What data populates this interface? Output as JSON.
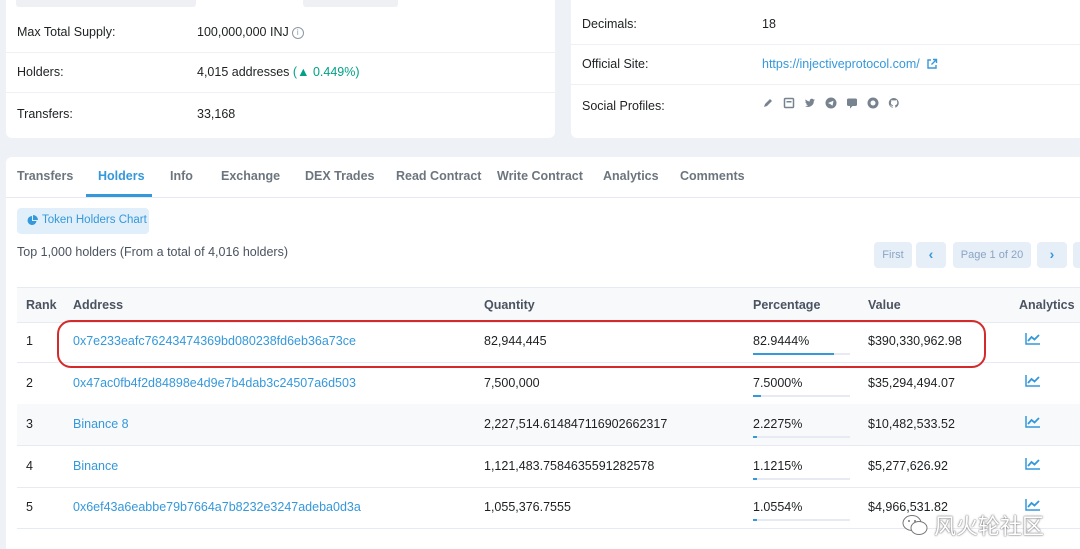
{
  "overview_left": {
    "rows": [
      {
        "key": "Max Total Supply:",
        "value": "100,000,000 INJ"
      },
      {
        "key": "Holders:",
        "value": "4,015 addresses",
        "change": "0.449%"
      },
      {
        "key": "Transfers:",
        "value": "33,168"
      }
    ]
  },
  "overview_right": {
    "rows": [
      {
        "key": "Decimals:",
        "value": "18"
      },
      {
        "key": "Official Site:",
        "value": "https://injectiveprotocol.com/"
      },
      {
        "key": "Social Profiles:"
      }
    ],
    "social_icons": [
      "pencil-icon",
      "blog-icon",
      "twitter-icon",
      "telegram-icon",
      "chat-icon",
      "coinmarketcap-icon",
      "github-icon"
    ]
  },
  "tabs": [
    "Transfers",
    "Holders",
    "Info",
    "Exchange",
    "DEX Trades",
    "Read Contract",
    "Write Contract",
    "Analytics",
    "Comments"
  ],
  "active_tab": "Holders",
  "holders_chart_button": "Token Holders Chart",
  "summary": "Top 1,000 holders (From a total of 4,016 holders)",
  "pager": {
    "first": "First",
    "page": "Page 1 of 20"
  },
  "table": {
    "headers": [
      "Rank",
      "Address",
      "Quantity",
      "Percentage",
      "Value",
      "Analytics"
    ],
    "rows": [
      {
        "rank": "1",
        "address": "0x7e233eafc76243474369bd080238fd6eb36a73ce",
        "quantity": "82,944,445",
        "percentage": "82.9444%",
        "pct_value": 0.829444,
        "value": "$390,330,962.98"
      },
      {
        "rank": "2",
        "address": "0x47ac0fb4f2d84898e4d9e7b4dab3c24507a6d503",
        "quantity": "7,500,000",
        "percentage": "7.5000%",
        "pct_value": 0.075,
        "value": "$35,294,494.07"
      },
      {
        "rank": "3",
        "address": "Binance 8",
        "quantity": "2,227,514.614847116902662317",
        "percentage": "2.2275%",
        "pct_value": 0.022275,
        "value": "$10,482,533.52"
      },
      {
        "rank": "4",
        "address": "Binance",
        "quantity": "1,121,483.7584635591282578",
        "percentage": "1.1215%",
        "pct_value": 0.011215,
        "value": "$5,277,626.92"
      },
      {
        "rank": "5",
        "address": "0x6ef43a6eabbe79b7664a7b8232e3247adeba0d3a",
        "quantity": "1,055,376.7555",
        "percentage": "1.0554%",
        "pct_value": 0.010554,
        "value": "$4,966,531.82"
      }
    ]
  },
  "watermark": "风火轮社区",
  "colors": {
    "accent": "#3498db",
    "positive": "#00a186",
    "highlight": "#d42a2a"
  }
}
